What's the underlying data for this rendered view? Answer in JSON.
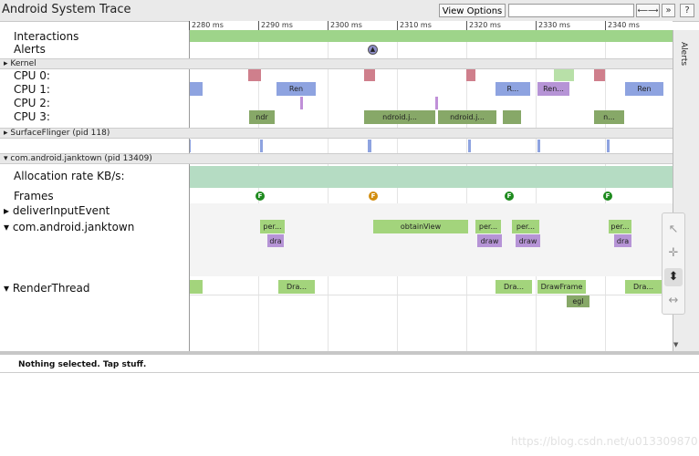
{
  "app": {
    "title": "Android System Trace"
  },
  "toolbar": {
    "view_options": "View Options ▾",
    "search_placeholder": "",
    "prev_label": "⟵⟶",
    "next_label": "»",
    "help_label": "?"
  },
  "ruler": {
    "ticks": [
      "2280 ms",
      "2290 ms",
      "2300 ms",
      "2310 ms",
      "2320 ms",
      "2330 ms",
      "2340 ms"
    ]
  },
  "sections": {
    "kernel": "▸ Kernel",
    "surfaceflinger": "▸ SurfaceFlinger (pid 118)",
    "janktown": "▾ com.android.janktown (pid 13409)"
  },
  "tracks": {
    "interactions": "Interactions",
    "alerts": "Alerts",
    "cpu0": "CPU 0:",
    "cpu1": "CPU 1:",
    "cpu2": "CPU 2:",
    "cpu3": "CPU 3:",
    "allocation_rate": "Allocation rate KB/s:",
    "frames": "Frames",
    "deliver_input": "▸ deliverInputEvent",
    "janktown_thread": "▾ com.android.janktown",
    "render_thread": "▾ RenderThread"
  },
  "slices": {
    "cpu1_ren1": "Ren",
    "cpu1_r": "R...",
    "cpu1_ren2": "Ren...",
    "cpu1_ren3": "Ren",
    "cpu3_ndr": "ndr",
    "cpu3_ndroid1": "ndroid.j...",
    "cpu3_ndroid2": "ndroid.j...",
    "cpu3_n": "n...",
    "jt_per1": "per...",
    "jt_dra1": "dra",
    "jt_obtain": "obtainView",
    "jt_per2": "per...",
    "jt_draw2": "draw",
    "jt_per3": "per...",
    "jt_draw3": "draw",
    "jt_per4": "per...",
    "jt_dra4": "dra",
    "rt_dra1": "Dra...",
    "rt_dra2": "Dra...",
    "rt_drawframe": "DrawFrame",
    "rt_egl": "egl",
    "rt_dra3": "Dra..."
  },
  "frames": {
    "f": "F"
  },
  "alerts_tab": "Alerts",
  "status": {
    "text": "Nothing selected. Tap stuff."
  },
  "watermark": "https://blog.csdn.net/u013309870",
  "colors": {
    "interaction_bar": "#9ed48a",
    "allocation_bar": "#b5dcc3",
    "frame_good": "#1e8a1e",
    "frame_warn": "#d28d0e",
    "slice_green": "#a3d47c",
    "slice_blue": "#94a6de",
    "slice_olive": "#87a868"
  },
  "tools": {
    "select": "select-tool",
    "pan": "pan-tool",
    "zoom": "zoom-tool",
    "timing": "timing-tool"
  }
}
